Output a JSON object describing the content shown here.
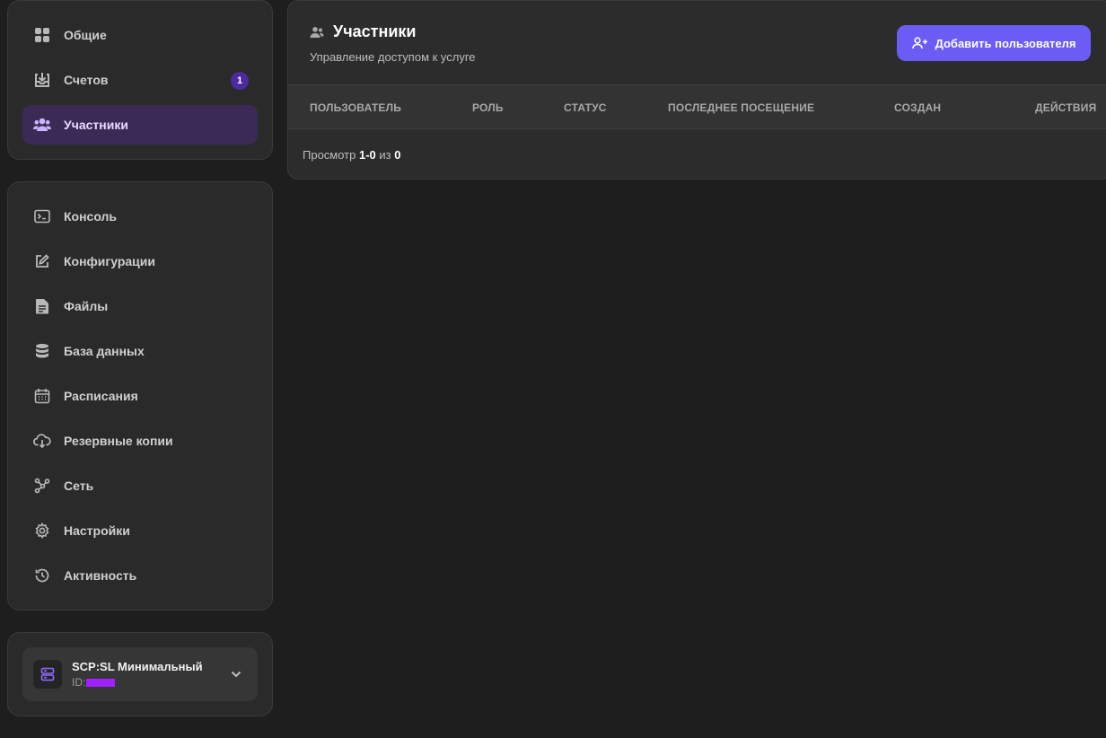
{
  "sidebar": {
    "primary": [
      {
        "label": "Общие",
        "icon": "grid-icon"
      },
      {
        "label": "Счетов",
        "icon": "download-box-icon",
        "badge": "1"
      },
      {
        "label": "Участники",
        "icon": "users-icon",
        "active": true
      }
    ],
    "secondary": [
      {
        "label": "Консоль",
        "icon": "terminal-icon"
      },
      {
        "label": "Конфигурации",
        "icon": "edit-icon"
      },
      {
        "label": "Файлы",
        "icon": "file-icon"
      },
      {
        "label": "База данных",
        "icon": "database-icon"
      },
      {
        "label": "Расписания",
        "icon": "calendar-icon"
      },
      {
        "label": "Резервные копии",
        "icon": "cloud-download-icon"
      },
      {
        "label": "Сеть",
        "icon": "network-icon"
      },
      {
        "label": "Настройки",
        "icon": "gear-icon"
      },
      {
        "label": "Активность",
        "icon": "history-icon"
      }
    ],
    "server": {
      "name": "SCP:SL Минимальный",
      "id_label": "ID:"
    }
  },
  "main": {
    "title": "Участники",
    "subtitle": "Управление доступом к услуге",
    "add_button": "Добавить пользователя",
    "columns": [
      "ПОЛЬЗОВАТЕЛЬ",
      "РОЛЬ",
      "СТАТУС",
      "ПОСЛЕДНЕЕ ПОСЕЩЕНИЕ",
      "СОЗДАН",
      "ДЕЙСТВИЯ"
    ],
    "footer": {
      "prefix": "Просмотр",
      "range": "1-0",
      "of": "из",
      "total": "0"
    }
  },
  "colors": {
    "background": "#1e1e1e",
    "panel": "#2a2a2a",
    "accent": "#6c5cf6",
    "active_nav": "#3b2a55",
    "badge": "#4c2aa0"
  }
}
